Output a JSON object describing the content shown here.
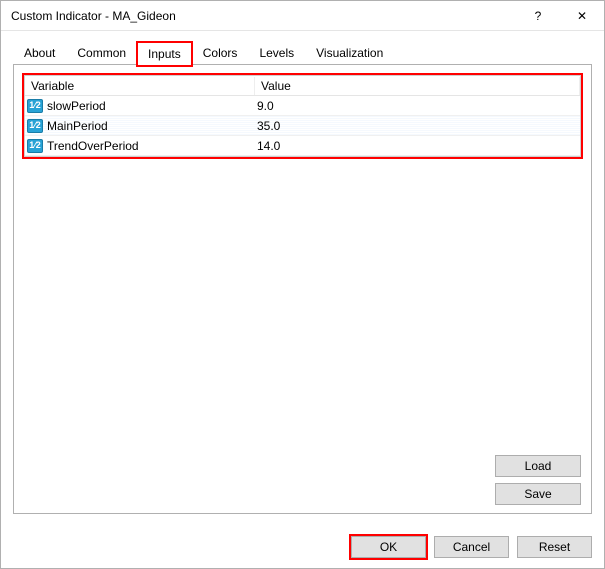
{
  "window": {
    "title": "Custom Indicator - MA_Gideon",
    "help_glyph": "?",
    "close_glyph": "✕"
  },
  "tabs": {
    "about": "About",
    "common": "Common",
    "inputs": "Inputs",
    "colors": "Colors",
    "levels": "Levels",
    "visualization": "Visualization"
  },
  "grid": {
    "header_variable": "Variable",
    "header_value": "Value",
    "icon_text": "1⁄2",
    "rows": [
      {
        "var": "slowPeriod",
        "val": "9.0"
      },
      {
        "var": "MainPeriod",
        "val": "35.0"
      },
      {
        "var": "TrendOverPeriod",
        "val": "14.0"
      }
    ]
  },
  "buttons": {
    "load": "Load",
    "save": "Save",
    "ok": "OK",
    "cancel": "Cancel",
    "reset": "Reset"
  }
}
